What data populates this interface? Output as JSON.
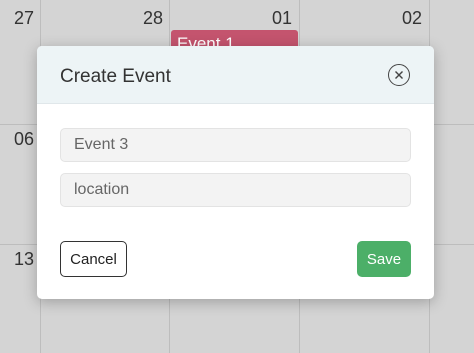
{
  "calendar": {
    "days": [
      "27",
      "28",
      "01",
      "02",
      "06",
      "13"
    ],
    "event_chip": "Event 1"
  },
  "modal": {
    "title": "Create Event",
    "close_icon": "close-circle-icon",
    "title_field": {
      "value": "Event 3",
      "placeholder": "Event 3"
    },
    "location_field": {
      "value": "",
      "placeholder": "location"
    },
    "cancel_label": "Cancel",
    "save_label": "Save"
  },
  "colors": {
    "event_chip": "#c4546e",
    "save_button": "#4caf68",
    "header_bg": "#edf4f6"
  }
}
